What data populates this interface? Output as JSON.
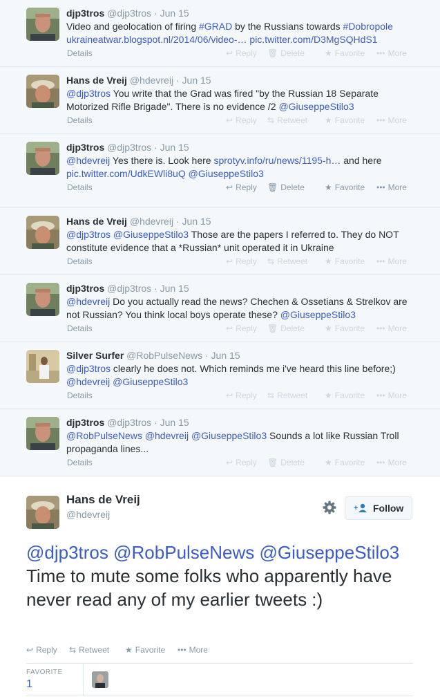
{
  "actions": {
    "details": "Details",
    "reply": "Reply",
    "retweet": "Retweet",
    "delete": "Delete",
    "favorite": "Favorite",
    "more": "More"
  },
  "tweets": [
    {
      "name": "djp3tros",
      "handle": "@djp3tros",
      "dot": "·",
      "time": "Jun 15",
      "line1": [
        {
          "t": "Video and geolocation of firing "
        },
        {
          "t": "#GRAD",
          "link": true
        },
        {
          "t": " by the Russians towards "
        },
        {
          "t": "#Dobropole",
          "link": true
        }
      ],
      "line2": [
        {
          "t": "ukraineatwar.blogspot.nl/2014/06/video-…",
          "link": true
        },
        {
          "t": " "
        },
        {
          "t": "pic.twitter.com/D3MgSQHdS1",
          "link": true
        }
      ]
    },
    {
      "name": "Hans de Vreij",
      "handle": "@hdevreij",
      "dot": "·",
      "time": "Jun 15",
      "line1": [
        {
          "t": "@djp3tros",
          "link": true
        },
        {
          "t": " You write that the Grad was fired \"by the Russian 18 Separate"
        }
      ],
      "line2": [
        {
          "t": "Motorized Rifle Brigade\". There is no evidence /2 "
        },
        {
          "t": "@GiuseppeStilo3",
          "link": true
        }
      ]
    },
    {
      "name": "djp3tros",
      "handle": "@djp3tros",
      "dot": "·",
      "time": "Jun 15",
      "line1": [
        {
          "t": "@hdevreij",
          "link": true
        },
        {
          "t": " Yes there is. Look here "
        },
        {
          "t": "sprotyv.info/ru/news/1195-h…",
          "link": true
        },
        {
          "t": " and here"
        }
      ],
      "line2": [
        {
          "t": "pic.twitter.com/UdkEWli8uQ",
          "link": true
        },
        {
          "t": " "
        },
        {
          "t": "@GiuseppeStilo3",
          "link": true
        }
      ]
    },
    {
      "name": "Hans de Vreij",
      "handle": "@hdevreij",
      "dot": "·",
      "time": "Jun 15",
      "line1": [
        {
          "t": "@djp3tros",
          "link": true
        },
        {
          "t": " "
        },
        {
          "t": "@GiuseppeStilo3",
          "link": true
        },
        {
          "t": " Those are the papers I referred to. They do NOT"
        }
      ],
      "line2": [
        {
          "t": "constitute evidence that a *Russian* unit operated it in Ukraine"
        }
      ]
    },
    {
      "name": "djp3tros",
      "handle": "@djp3tros",
      "dot": "·",
      "time": "Jun 15",
      "line1": [
        {
          "t": "@hdevreij",
          "link": true
        },
        {
          "t": " Do you actually read the news? Chechen & Ossetians & Strelkov are"
        }
      ],
      "line2": [
        {
          "t": "not Russian? You think local boys operate these? "
        },
        {
          "t": "@GiuseppeStilo3",
          "link": true
        }
      ]
    },
    {
      "name": "Silver Surfer",
      "handle": "@RobPulseNews",
      "dot": "·",
      "time": "Jun 15",
      "line1": [
        {
          "t": "@djp3tros",
          "link": true
        },
        {
          "t": " clearly he does not. Which reminds me i've heard this line before;)"
        }
      ],
      "line2": [
        {
          "t": "@hdevreij",
          "link": true
        },
        {
          "t": " "
        },
        {
          "t": "@GiuseppeStilo3",
          "link": true
        }
      ]
    },
    {
      "name": "djp3tros",
      "handle": "@djp3tros",
      "dot": "·",
      "time": "Jun 15",
      "line1": [
        {
          "t": "@RobPulseNews",
          "link": true
        },
        {
          "t": " "
        },
        {
          "t": "@hdevreij",
          "link": true
        },
        {
          "t": " "
        },
        {
          "t": "@GiuseppeStilo3",
          "link": true
        },
        {
          "t": " Sounds a lot like Russian Troll"
        }
      ],
      "line2": [
        {
          "t": "propaganda lines..."
        }
      ]
    }
  ],
  "main": {
    "name": "Hans de Vreij",
    "handle": "@hdevreij",
    "follow_label": "Follow",
    "text": [
      {
        "t": "@djp3tros",
        "link": true
      },
      {
        "t": " "
      },
      {
        "t": "@RobPulseNews",
        "link": true
      },
      {
        "t": " "
      },
      {
        "t": "@GiuseppeStilo3",
        "link": true
      },
      {
        "t": " Time to mute some folks who apparently have never read any of my earlier tweets :)"
      }
    ],
    "favorite_label": "FAVORITE",
    "favorite_count": "1"
  },
  "colors": {
    "link": "#3b5bc6",
    "muted": "#8899a6",
    "faint": "#ccd6dd",
    "thread_bg": "#f5f8fa"
  }
}
